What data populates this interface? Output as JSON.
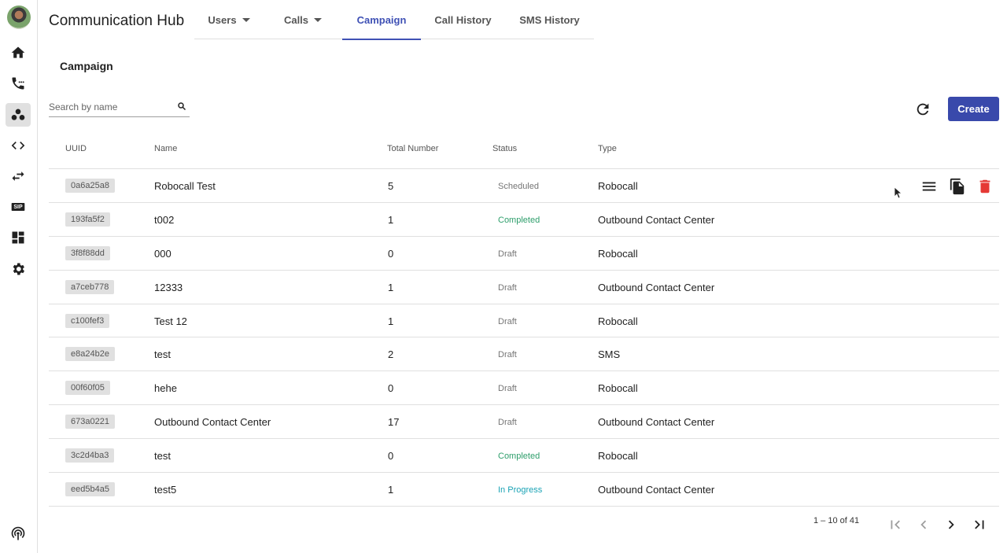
{
  "app": {
    "title": "Communication Hub"
  },
  "tabs": [
    {
      "label": "Users",
      "has_caret": true,
      "active": false
    },
    {
      "label": "Calls",
      "has_caret": true,
      "active": false
    },
    {
      "label": "Campaign",
      "has_caret": false,
      "active": true
    },
    {
      "label": "Call History",
      "has_caret": false,
      "active": false
    },
    {
      "label": "SMS History",
      "has_caret": false,
      "active": false
    }
  ],
  "sidebar": {
    "icons": [
      "home-icon",
      "phone-call-icon",
      "campaign-icon",
      "code-icon",
      "swap-icon",
      "sip-icon",
      "dashboard-icon",
      "settings-icon",
      "broadcast-icon"
    ],
    "active": "campaign-icon",
    "sip_text": "SIP"
  },
  "page": {
    "section_title": "Campaign"
  },
  "search": {
    "placeholder": "Search by name",
    "value": ""
  },
  "toolbar": {
    "create_label": "Create"
  },
  "table": {
    "headers": {
      "uuid": "UUID",
      "name": "Name",
      "total": "Total Number",
      "status": "Status",
      "type": "Type"
    },
    "rows": [
      {
        "uuid": "0a6a25a8",
        "name": "Robocall Test",
        "total": "5",
        "status": "Scheduled",
        "type": "Robocall"
      },
      {
        "uuid": "193fa5f2",
        "name": "t002",
        "total": "1",
        "status": "Completed",
        "type": "Outbound Contact Center"
      },
      {
        "uuid": "3f8f88dd",
        "name": "000",
        "total": "0",
        "status": "Draft",
        "type": "Robocall"
      },
      {
        "uuid": "a7ceb778",
        "name": "12333",
        "total": "1",
        "status": "Draft",
        "type": "Outbound Contact Center"
      },
      {
        "uuid": "c100fef3",
        "name": "Test 12",
        "total": "1",
        "status": "Draft",
        "type": "Robocall"
      },
      {
        "uuid": "e8a24b2e",
        "name": "test",
        "total": "2",
        "status": "Draft",
        "type": "SMS"
      },
      {
        "uuid": "00f60f05",
        "name": "hehe",
        "total": "0",
        "status": "Draft",
        "type": "Robocall"
      },
      {
        "uuid": "673a0221",
        "name": "Outbound Contact Center",
        "total": "17",
        "status": "Draft",
        "type": "Outbound Contact Center"
      },
      {
        "uuid": "3c2d4ba3",
        "name": "test",
        "total": "0",
        "status": "Completed",
        "type": "Robocall"
      },
      {
        "uuid": "eed5b4a5",
        "name": "test5",
        "total": "1",
        "status": "In Progress",
        "type": "Outbound Contact Center"
      }
    ],
    "row_actions": [
      "menu-icon",
      "copy-icon",
      "delete-icon"
    ]
  },
  "status_colors": {
    "Scheduled": "#757575",
    "Draft": "#757575",
    "Completed": "#2e9e6b",
    "In Progress": "#1aa3b5"
  },
  "colors": {
    "accent": "#3f51b5",
    "button": "#3949ab",
    "delete": "#e53935"
  },
  "pagination": {
    "range_text": "1 – 10 of 41"
  }
}
